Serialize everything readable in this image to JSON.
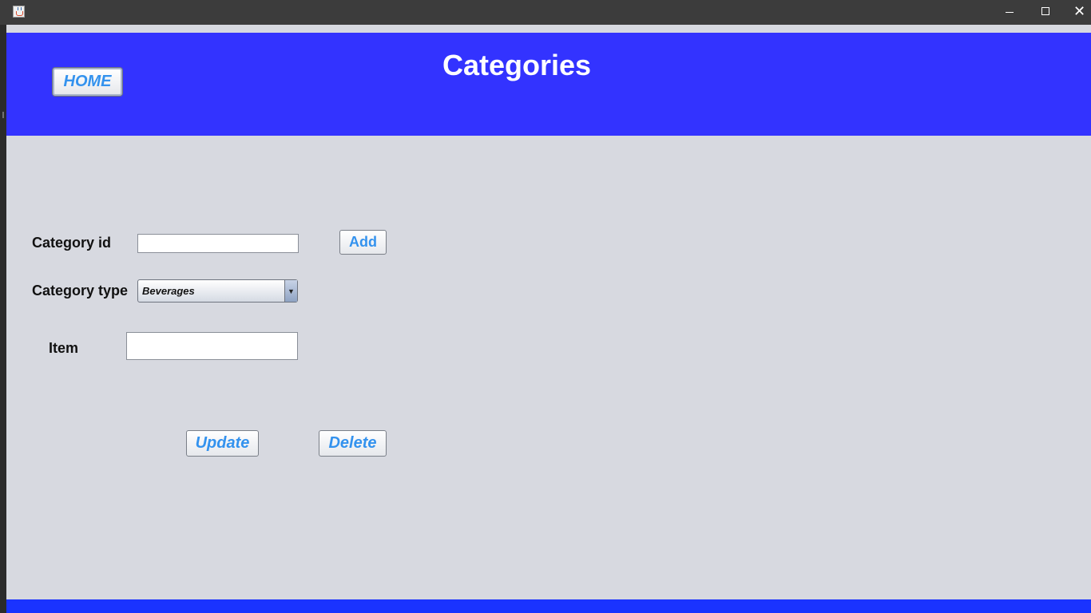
{
  "window": {
    "minimize_label": "—",
    "maximize_label": "☐",
    "close_label": "✕",
    "app_icon": "java-cup-icon"
  },
  "header": {
    "title": "Categories",
    "home_button": "HOME",
    "background_color": "#3333ff"
  },
  "form": {
    "category_id": {
      "label": "Category id",
      "value": ""
    },
    "category_type": {
      "label": "Category type",
      "selected": "Beverages"
    },
    "item": {
      "label": "Item",
      "value": ""
    },
    "add_button": "Add",
    "update_button": "Update",
    "delete_button": "Delete"
  },
  "colors": {
    "content_background": "#d7d9e0",
    "button_text": "#3392ee",
    "footer_bar": "#1a33ff"
  }
}
